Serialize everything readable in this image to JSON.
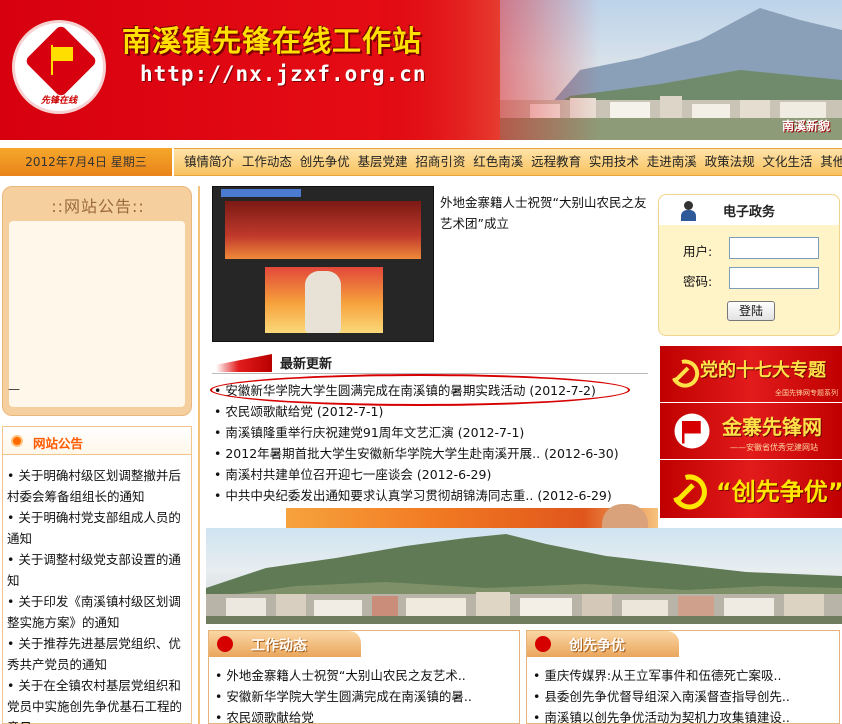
{
  "banner": {
    "title": "南溪镇先锋在线工作站",
    "url": "http://nx.jzxf.org.cn",
    "logo_text": "先锋在线",
    "caption": "南溪新貌"
  },
  "nav": {
    "date": "2012年7月4日  星期三",
    "links": [
      "镇情简介",
      "工作动态",
      "创先争优",
      "基层党建",
      "招商引资",
      "红色南溪",
      "远程教育",
      "实用技术",
      "走进南溪",
      "政策法规",
      "文化生活",
      "其他"
    ]
  },
  "notice_box": {
    "title": "::网站公告::",
    "dash": "—"
  },
  "announcements": {
    "title": "网站公告",
    "items": [
      "• 关于明确村级区划调整撤并后村委会筹备组组长的通知",
      "• 关于明确村党支部组成人员的通知",
      "• 关于调整村级党支部设置的通知",
      "• 关于印发《南溪镇村级区划调整实施方案》的通知",
      "• 关于推荐先进基层党组织、优秀共产党员的通知",
      "• 关于在全镇农村基层党组织和党员中实施创先争优基石工程的意见"
    ]
  },
  "featured": {
    "caption": "外地金寨籍人士祝贺“大别山农民之友艺术团”成立"
  },
  "latest": {
    "title": "最新更新",
    "items": [
      {
        "text": "安徽新华学院大学生圆满完成在南溪镇的暑期实践活动",
        "date": "(2012-7-2)"
      },
      {
        "text": "农民颂歌献给党",
        "date": "(2012-7-1)"
      },
      {
        "text": "南溪镇隆重举行庆祝建党91周年文艺汇演",
        "date": "(2012-7-1)"
      },
      {
        "text": "2012年暑期首批大学生安徽新华学院大学生赴南溪开展..",
        "date": "(2012-6-30)"
      },
      {
        "text": "南溪村共建单位召开迎七一座谈会",
        "date": "(2012-6-29)"
      },
      {
        "text": "中共中央纪委发出通知要求认真学习贯彻胡锦涛同志重..",
        "date": "(2012-6-29)"
      }
    ]
  },
  "work_panel": {
    "title": "工作动态",
    "items": [
      "• 外地金寨籍人士祝贺“大别山农民之友艺术..",
      "• 安徽新华学院大学生圆满完成在南溪镇的暑..",
      "• 农民颂歌献给党"
    ]
  },
  "cxzy_panel": {
    "title": "创先争优",
    "items": [
      "• 重庆传媒界:从王立军事件和伍德死亡案吸..",
      "• 县委创先争优督导组深入南溪督查指导创先..",
      "• 南溪镇以创先争优活动为契机力攻集镇建设.."
    ]
  },
  "egov": {
    "title": "电子政务",
    "user_label": "用户:",
    "pass_label": "密码:",
    "login": "登陆"
  },
  "promos": {
    "p1": "党的十七大专题",
    "p1_sub": "全国先锋网专题系列",
    "p2": "金寨先锋网",
    "p2_sub": "——安徽省优秀党建网站",
    "p3": "“创先争优”"
  },
  "colors": {
    "banner_red": "#d7000f",
    "title_yellow": "#ffe000",
    "accent_orange": "#ff5a00",
    "nav_bar": "#f8c25f",
    "highlight_red": "#d60000"
  }
}
